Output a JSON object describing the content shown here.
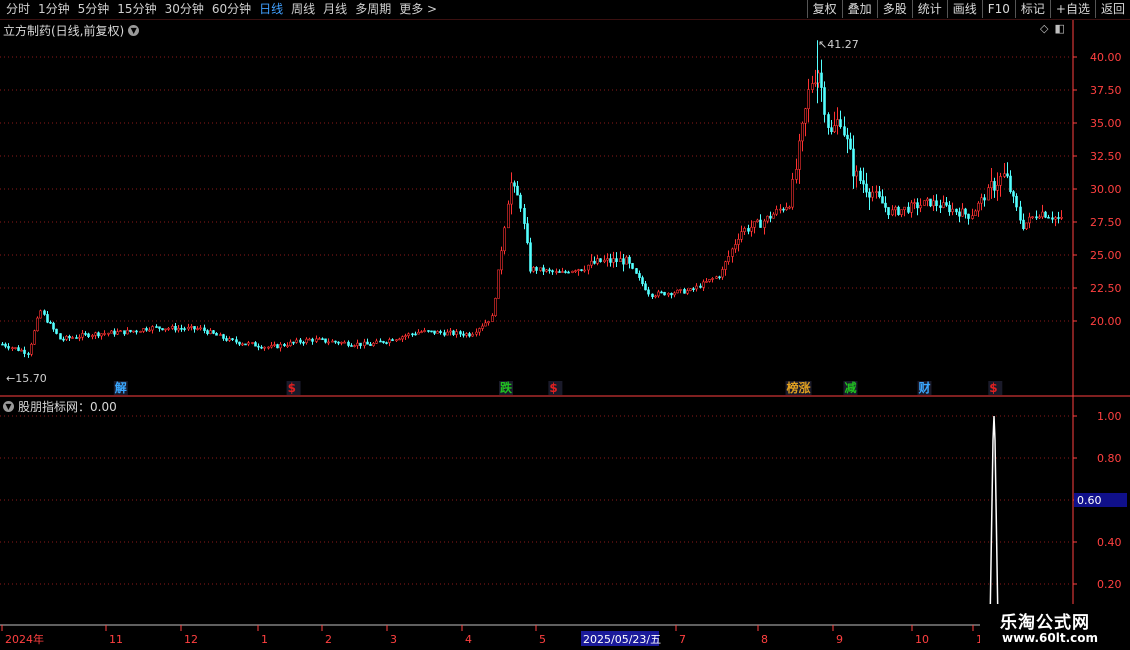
{
  "toolbar": {
    "periods": [
      "分时",
      "1分钟",
      "5分钟",
      "15分钟",
      "30分钟",
      "60分钟",
      "日线",
      "周线",
      "月线",
      "多周期",
      "更多 >"
    ],
    "active_period": "日线",
    "buttons": [
      "复权",
      "叠加",
      "多股",
      "统计",
      "画线",
      "F10",
      "标记",
      "+自选",
      "返回"
    ]
  },
  "main_chart": {
    "title": "立方制药(日线,前复权)",
    "price_axis": [
      "40.00",
      "37.50",
      "35.00",
      "32.50",
      "30.00",
      "27.50",
      "25.00",
      "22.50",
      "20.00"
    ],
    "high_label": "41.27",
    "low_label": "15.70",
    "event_markers": [
      {
        "text": "解",
        "color": "#3aa8ff",
        "pos": 0.107
      },
      {
        "text": "$",
        "color": "#e02020",
        "pos": 0.268
      },
      {
        "text": "跌",
        "color": "#20c020",
        "pos": 0.466
      },
      {
        "text": "$",
        "color": "#e02020",
        "pos": 0.512
      },
      {
        "text": "榜涨",
        "color": "#e0a020",
        "pos": 0.733
      },
      {
        "text": "减",
        "color": "#20c020",
        "pos": 0.787
      },
      {
        "text": "财",
        "color": "#3aa8ff",
        "pos": 0.856
      },
      {
        "text": "$",
        "color": "#e02020",
        "pos": 0.922
      }
    ]
  },
  "indicator": {
    "title": "股朋指标网：0.00",
    "axis": [
      "1.00",
      "0.80",
      "0.60",
      "0.40",
      "0.20"
    ],
    "current_value": "0.60"
  },
  "time_axis": {
    "labels": [
      "2024年",
      "11",
      "12",
      "1",
      "2",
      "3",
      "4",
      "5",
      "7",
      "8",
      "9",
      "10",
      "1"
    ],
    "cursor_date": "2025/05/23/五"
  },
  "watermark": {
    "name": "乐淘公式网",
    "url": "www.60lt.com"
  },
  "colors": {
    "up": "#ff3232",
    "down": "#54ffff",
    "grid": "#8b1a1a",
    "axis_text": "#ff4040",
    "active": "#40a0ff"
  }
}
